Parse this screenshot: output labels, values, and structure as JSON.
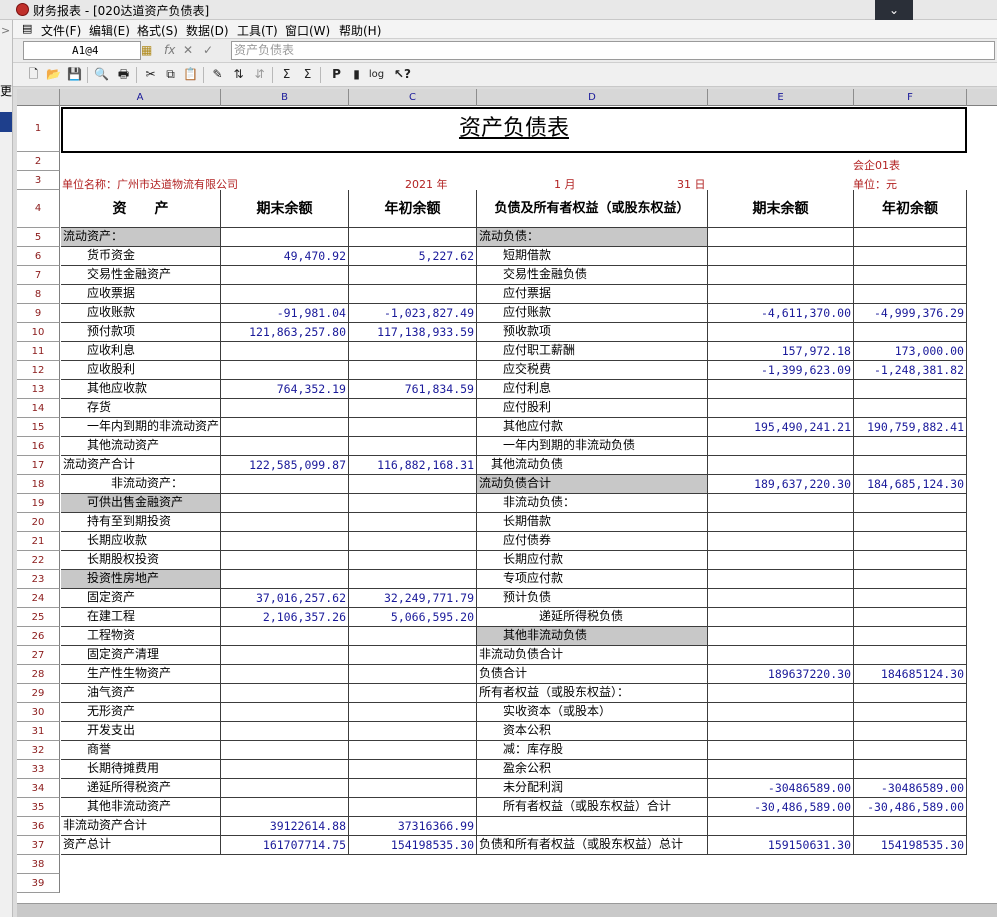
{
  "window": {
    "title": "财务报表 - [020达道资产负债表]",
    "dropdown_glyph": "⌄"
  },
  "menu": [
    "文件(F)",
    "编辑(E)",
    "格式(S)",
    "数据(D)",
    "工具(T)",
    "窗口(W)",
    "帮助(H)"
  ],
  "formula": {
    "cell_ref": "A1@4",
    "value": "资产负债表"
  },
  "left_strip": {
    "char": "更",
    "arrow": ">"
  },
  "columns": [
    "A",
    "B",
    "C",
    "D",
    "E",
    "F"
  ],
  "rows": [
    "1",
    "2",
    "3",
    "4",
    "5",
    "6",
    "7",
    "8",
    "9",
    "10",
    "11",
    "12",
    "13",
    "14",
    "15",
    "16",
    "17",
    "18",
    "19",
    "20",
    "21",
    "22",
    "23",
    "24",
    "25",
    "26",
    "27",
    "28",
    "29",
    "30",
    "31",
    "32",
    "33",
    "34",
    "35",
    "36",
    "37",
    "38",
    "39"
  ],
  "report": {
    "title": "资产负债表",
    "form_code": "会企01表",
    "unit_label": "单位名称：广州市达道物流有限公司",
    "year": "2021 年",
    "month": "1 月",
    "day": "31 日",
    "currency_unit": "单位：元",
    "headers": [
      "资　　产",
      "期末余额",
      "年初余额",
      "负债及所有者权益（或股东权益）",
      "期末余额",
      "年初余额"
    ]
  },
  "table": [
    {
      "a": "流动资产：",
      "b": "",
      "c": "",
      "d": "流动负债：",
      "e": "",
      "f": ""
    },
    {
      "a": "　　货币资金",
      "b": "49,470.92",
      "c": "5,227.62",
      "d": "　　短期借款",
      "e": "",
      "f": ""
    },
    {
      "a": "　　交易性金融资产",
      "b": "",
      "c": "",
      "d": "　　交易性金融负债",
      "e": "",
      "f": ""
    },
    {
      "a": "　　应收票据",
      "b": "",
      "c": "",
      "d": "　　应付票据",
      "e": "",
      "f": ""
    },
    {
      "a": "　　应收账款",
      "b": "-91,981.04",
      "c": "-1,023,827.49",
      "d": "　　应付账款",
      "e": "-4,611,370.00",
      "f": "-4,999,376.29"
    },
    {
      "a": "　　预付款项",
      "b": "121,863,257.80",
      "c": "117,138,933.59",
      "d": "　　预收款项",
      "e": "",
      "f": ""
    },
    {
      "a": "　　应收利息",
      "b": "",
      "c": "",
      "d": "　　应付职工薪酬",
      "e": "157,972.18",
      "f": "173,000.00"
    },
    {
      "a": "　　应收股利",
      "b": "",
      "c": "",
      "d": "　　应交税费",
      "e": "-1,399,623.09",
      "f": "-1,248,381.82"
    },
    {
      "a": "　　其他应收款",
      "b": "764,352.19",
      "c": "761,834.59",
      "d": "　　应付利息",
      "e": "",
      "f": ""
    },
    {
      "a": "　　存货",
      "b": "",
      "c": "",
      "d": "　　应付股利",
      "e": "",
      "f": ""
    },
    {
      "a": "　　一年内到期的非流动资产",
      "b": "",
      "c": "",
      "d": "　　其他应付款",
      "e": "195,490,241.21",
      "f": "190,759,882.41"
    },
    {
      "a": "　　其他流动资产",
      "b": "",
      "c": "",
      "d": "　　一年内到期的非流动负债",
      "e": "",
      "f": ""
    },
    {
      "a": "流动资产合计",
      "b": "122,585,099.87",
      "c": "116,882,168.31",
      "d": "　其他流动负债",
      "e": "",
      "f": ""
    },
    {
      "a": "　　　　非流动资产：",
      "b": "",
      "c": "",
      "d": "流动负债合计",
      "e": "189,637,220.30",
      "f": "184,685,124.30"
    },
    {
      "a": "　　可供出售金融资产",
      "b": "",
      "c": "",
      "d": "　　非流动负债：",
      "e": "",
      "f": ""
    },
    {
      "a": "　　持有至到期投资",
      "b": "",
      "c": "",
      "d": "　　长期借款",
      "e": "",
      "f": ""
    },
    {
      "a": "　　长期应收款",
      "b": "",
      "c": "",
      "d": "　　应付债券",
      "e": "",
      "f": ""
    },
    {
      "a": "　　长期股权投资",
      "b": "",
      "c": "",
      "d": "　　长期应付款",
      "e": "",
      "f": ""
    },
    {
      "a": "　　投资性房地产",
      "b": "",
      "c": "",
      "d": "　　专项应付款",
      "e": "",
      "f": ""
    },
    {
      "a": "　　固定资产",
      "b": "37,016,257.62",
      "c": "32,249,771.79",
      "d": "　　预计负债",
      "e": "",
      "f": ""
    },
    {
      "a": "　　在建工程",
      "b": "2,106,357.26",
      "c": "5,066,595.20",
      "d": "　　　　　递延所得税负债",
      "e": "",
      "f": ""
    },
    {
      "a": "　　工程物资",
      "b": "",
      "c": "",
      "d": "　　其他非流动负债",
      "e": "",
      "f": ""
    },
    {
      "a": "　　固定资产清理",
      "b": "",
      "c": "",
      "d": "非流动负债合计",
      "e": "",
      "f": ""
    },
    {
      "a": "　　生产性生物资产",
      "b": "",
      "c": "",
      "d": "负债合计",
      "e": "189637220.30",
      "f": "184685124.30"
    },
    {
      "a": "　　油气资产",
      "b": "",
      "c": "",
      "d": "所有者权益（或股东权益）：",
      "e": "",
      "f": ""
    },
    {
      "a": "　　无形资产",
      "b": "",
      "c": "",
      "d": "　　实收资本（或股本）",
      "e": "",
      "f": ""
    },
    {
      "a": "　　开发支出",
      "b": "",
      "c": "",
      "d": "　　资本公积",
      "e": "",
      "f": ""
    },
    {
      "a": "　　商誉",
      "b": "",
      "c": "",
      "d": "　　减：库存股",
      "e": "",
      "f": ""
    },
    {
      "a": "　　长期待摊费用",
      "b": "",
      "c": "",
      "d": "　　盈余公积",
      "e": "",
      "f": ""
    },
    {
      "a": "　　递延所得税资产",
      "b": "",
      "c": "",
      "d": "　　未分配利润",
      "e": "-30486589.00",
      "f": "-30486589.00"
    },
    {
      "a": "　　其他非流动资产",
      "b": "",
      "c": "",
      "d": "　　所有者权益（或股东权益）合计",
      "e": "-30,486,589.00",
      "f": "-30,486,589.00"
    },
    {
      "a": "非流动资产合计",
      "b": "39122614.88",
      "c": "37316366.99",
      "d": "",
      "e": "",
      "f": ""
    },
    {
      "a": "资产总计",
      "b": "161707714.75",
      "c": "154198535.30",
      "d": "负债和所有者权益（或股东权益）总计",
      "e": "159150631.30",
      "f": "154198535.30"
    }
  ]
}
